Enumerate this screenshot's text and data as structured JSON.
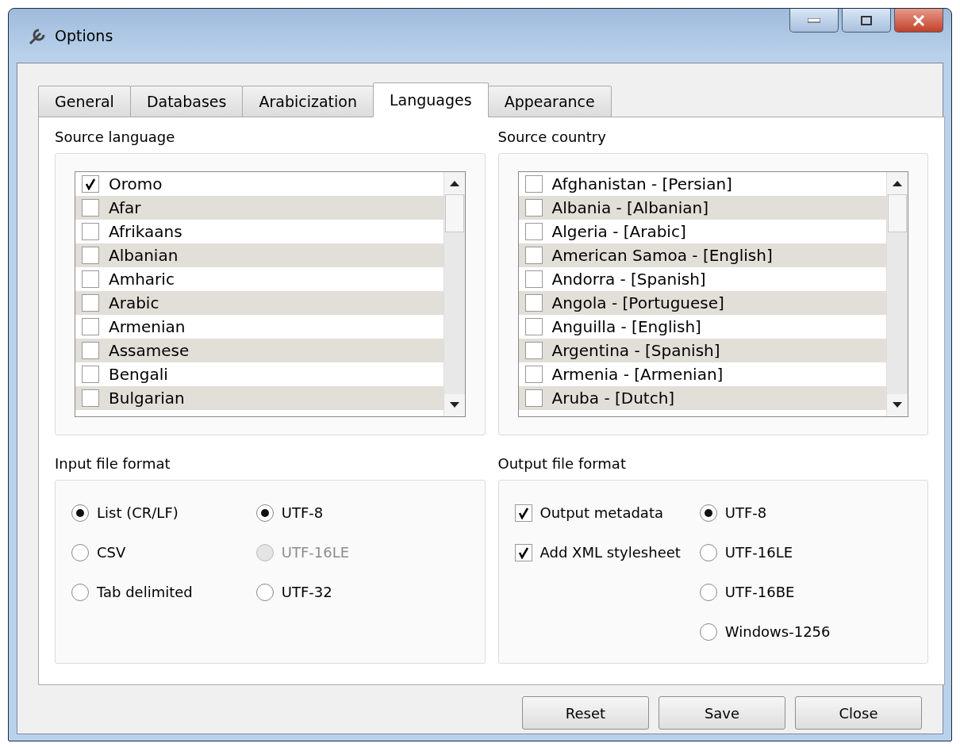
{
  "window": {
    "title": "Options"
  },
  "tabs": [
    {
      "label": "General",
      "selected": false
    },
    {
      "label": "Databases",
      "selected": false
    },
    {
      "label": "Arabicization",
      "selected": false
    },
    {
      "label": "Languages",
      "selected": true
    },
    {
      "label": "Appearance",
      "selected": false
    }
  ],
  "source_language": {
    "title": "Source language",
    "items": [
      {
        "label": "Oromo",
        "checked": true
      },
      {
        "label": "Afar",
        "checked": false
      },
      {
        "label": "Afrikaans",
        "checked": false
      },
      {
        "label": "Albanian",
        "checked": false
      },
      {
        "label": "Amharic",
        "checked": false
      },
      {
        "label": "Arabic",
        "checked": false
      },
      {
        "label": "Armenian",
        "checked": false
      },
      {
        "label": "Assamese",
        "checked": false
      },
      {
        "label": "Bengali",
        "checked": false
      },
      {
        "label": "Bulgarian",
        "checked": false
      }
    ]
  },
  "source_country": {
    "title": "Source country",
    "items": [
      {
        "label": "Afghanistan - [Persian]",
        "checked": false
      },
      {
        "label": "Albania - [Albanian]",
        "checked": false
      },
      {
        "label": "Algeria - [Arabic]",
        "checked": false
      },
      {
        "label": "American Samoa - [English]",
        "checked": false
      },
      {
        "label": "Andorra - [Spanish]",
        "checked": false
      },
      {
        "label": "Angola - [Portuguese]",
        "checked": false
      },
      {
        "label": "Anguilla - [English]",
        "checked": false
      },
      {
        "label": "Argentina - [Spanish]",
        "checked": false
      },
      {
        "label": "Armenia - [Armenian]",
        "checked": false
      },
      {
        "label": "Aruba - [Dutch]",
        "checked": false
      }
    ]
  },
  "input_file_format": {
    "title": "Input file format",
    "columns": [
      [
        {
          "kind": "radio",
          "label": "List (CR/LF)",
          "selected": true,
          "disabled": false
        },
        {
          "kind": "radio",
          "label": "CSV",
          "selected": false,
          "disabled": false
        },
        {
          "kind": "radio",
          "label": "Tab delimited",
          "selected": false,
          "disabled": false
        }
      ],
      [
        {
          "kind": "radio",
          "label": "UTF-8",
          "selected": true,
          "disabled": false
        },
        {
          "kind": "radio",
          "label": "UTF-16LE",
          "selected": false,
          "disabled": true
        },
        {
          "kind": "radio",
          "label": "UTF-32",
          "selected": false,
          "disabled": false
        }
      ]
    ]
  },
  "output_file_format": {
    "title": "Output file format",
    "columns": [
      [
        {
          "kind": "checkbox",
          "label": "Output metadata",
          "checked": true
        },
        {
          "kind": "checkbox",
          "label": "Add XML stylesheet",
          "checked": true
        }
      ],
      [
        {
          "kind": "radio",
          "label": "UTF-8",
          "selected": true,
          "disabled": false
        },
        {
          "kind": "radio",
          "label": "UTF-16LE",
          "selected": false,
          "disabled": false
        },
        {
          "kind": "radio",
          "label": "UTF-16BE",
          "selected": false,
          "disabled": false
        },
        {
          "kind": "radio",
          "label": "Windows-1256",
          "selected": false,
          "disabled": false
        }
      ]
    ]
  },
  "buttons": [
    "Reset",
    "Save",
    "Close"
  ]
}
